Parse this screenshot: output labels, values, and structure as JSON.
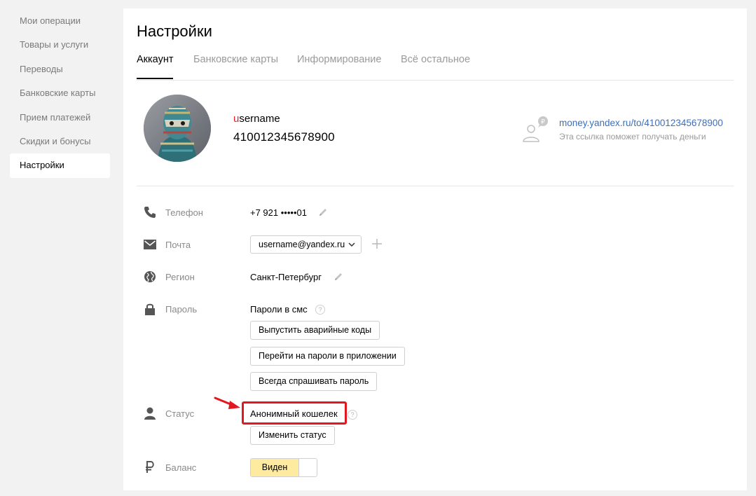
{
  "sidebar": {
    "items": [
      {
        "label": "Мои операции"
      },
      {
        "label": "Товары и услуги"
      },
      {
        "label": "Переводы"
      },
      {
        "label": "Банковские карты"
      },
      {
        "label": "Прием платежей"
      },
      {
        "label": "Скидки и бонусы"
      },
      {
        "label": "Настройки",
        "active": true
      }
    ]
  },
  "page": {
    "title": "Настройки"
  },
  "tabs": [
    {
      "label": "Аккаунт",
      "active": true
    },
    {
      "label": "Банковские карты"
    },
    {
      "label": "Информирование"
    },
    {
      "label": "Всё остальное"
    }
  ],
  "profile": {
    "username_first": "u",
    "username_rest": "sername",
    "account_number": "410012345678900",
    "money_link": "money.yandex.ru/to/410012345678900",
    "link_hint": "Эта ссылка поможет получать деньги"
  },
  "rows": {
    "phone": {
      "label": "Телефон",
      "value": "+7 921 •••••01",
      "icon": "phone-icon"
    },
    "email": {
      "label": "Почта",
      "value": "username@yandex.ru",
      "icon": "mail-icon"
    },
    "region": {
      "label": "Регион",
      "value": "Санкт-Петербург",
      "icon": "globe-icon"
    },
    "password": {
      "label": "Пароль",
      "value": "Пароли в смс",
      "icon": "lock-icon",
      "help": "?",
      "buttons": [
        "Выпустить аварийные коды",
        "Перейти на пароли в приложении",
        "Всегда спрашивать пароль"
      ]
    },
    "status": {
      "label": "Статус",
      "value": "Анонимный кошелек",
      "button": "Изменить статус",
      "icon": "user-icon",
      "help": "?"
    },
    "balance": {
      "label": "Баланс",
      "toggle_label": "Виден",
      "icon": "ruble-icon"
    }
  },
  "colors": {
    "accent_link": "#3b6fbf",
    "highlight": "#e3171f",
    "toggle_on": "#ffeba0"
  }
}
